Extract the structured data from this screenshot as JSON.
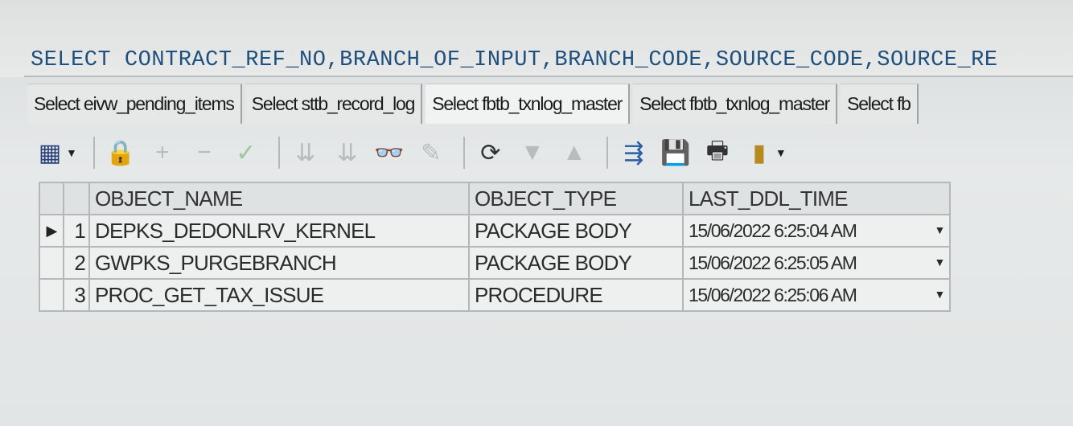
{
  "editor": {
    "sql_text": "SELECT CONTRACT_REF_NO,BRANCH_OF_INPUT,BRANCH_CODE,SOURCE_CODE,SOURCE_RE"
  },
  "tabs": [
    {
      "label": "Select eivw_pending_items"
    },
    {
      "label": "Select sttb_record_log"
    },
    {
      "label": "Select fbtb_txnlog_master"
    },
    {
      "label": "Select fbtb_txnlog_master"
    },
    {
      "label": "Select fb"
    }
  ],
  "toolbar": {
    "icons": [
      "grid-view-icon",
      "lock-icon",
      "add-record-icon",
      "delete-record-icon",
      "post-edit-icon",
      "filter-icon",
      "clear-filter-icon",
      "find-icon",
      "edit-icon",
      "refresh-icon",
      "sort-desc-icon",
      "sort-asc-icon",
      "export-icon",
      "save-icon",
      "print-icon",
      "chart-icon"
    ]
  },
  "grid": {
    "columns": [
      "OBJECT_NAME",
      "OBJECT_TYPE",
      "LAST_DDL_TIME"
    ],
    "rows": [
      {
        "n": "1",
        "name": "DEPKS_DEDONLRV_KERNEL",
        "type": "PACKAGE BODY",
        "time": "15/06/2022 6:25:04 AM"
      },
      {
        "n": "2",
        "name": "GWPKS_PURGEBRANCH",
        "type": "PACKAGE BODY",
        "time": "15/06/2022 6:25:05 AM"
      },
      {
        "n": "3",
        "name": "PROC_GET_TAX_ISSUE",
        "type": "PROCEDURE",
        "time": "15/06/2022 6:25:06 AM"
      }
    ],
    "current_row_marker": "▶"
  }
}
